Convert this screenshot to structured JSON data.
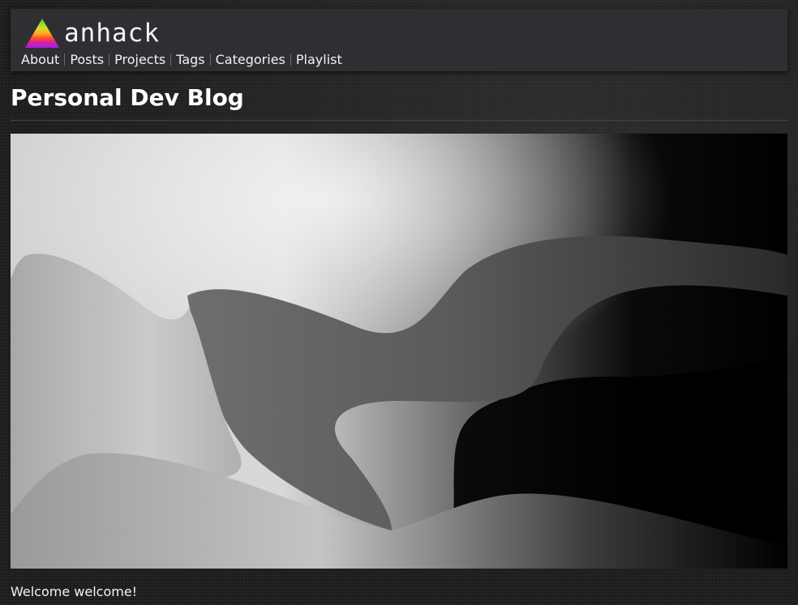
{
  "site": {
    "logo_text": "anhack"
  },
  "nav": {
    "items": [
      {
        "label": "About"
      },
      {
        "label": "Posts"
      },
      {
        "label": "Projects"
      },
      {
        "label": "Tags"
      },
      {
        "label": "Categories"
      },
      {
        "label": "Playlist"
      }
    ]
  },
  "page": {
    "title": "Personal Dev Blog",
    "welcome": "Welcome welcome!"
  },
  "colors": {
    "background": "#232323",
    "header_bg": "#2f2f33",
    "text": "#f2f2f2"
  },
  "icons": {
    "logo": "rainbow-triangle-icon"
  }
}
